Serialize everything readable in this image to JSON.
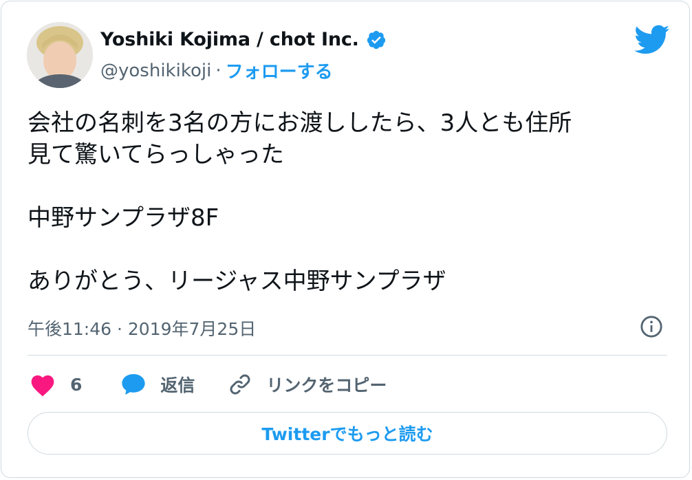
{
  "author": {
    "name": "Yoshiki Kojima / chot Inc.",
    "handle": "@yoshikikoji",
    "separator": "·",
    "follow_label": "フォローする"
  },
  "tweet": {
    "lines": [
      "会社の名刺を3名の方にお渡ししたら、3人とも住所",
      "見て驚いてらっしゃった",
      "中野サンプラザ8F",
      "ありがとう、リージャス中野サンプラザ"
    ],
    "timestamp": "午後11:46 · 2019年7月25日"
  },
  "actions": {
    "like_count": "6",
    "reply_label": "返信",
    "copy_link_label": "リンクをコピー"
  },
  "read_more_label": "Twitterでもっと読む",
  "colors": {
    "accent": "#1d9bf0",
    "like": "#f91880",
    "secondary_text": "#536471",
    "border": "#cfd9de"
  },
  "icons": [
    "verified-badge-icon",
    "twitter-bird-icon",
    "info-icon",
    "heart-icon",
    "reply-bubble-icon",
    "link-icon"
  ]
}
